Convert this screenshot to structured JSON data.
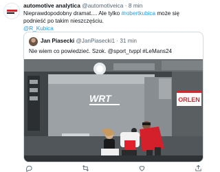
{
  "tweet": {
    "author_name": "automotive analytica",
    "author_handle": "@automotiveica",
    "separator": "·",
    "time": "8 min",
    "text_before_link": "Nieprawdopodobny dramat.... Ale tylko ",
    "link_hashtag": "#robertkubica",
    "text_after_link": " może się podnieść po takim nieszczęściu.",
    "mention": "@R_Kubica"
  },
  "quoted": {
    "author_name": "Jan Piasecki",
    "author_handle": "@JanPiasecki1",
    "separator": "·",
    "time": "31 min",
    "text": "Nie wiem co powiedzieć. Szok. @sport_tvppl #LeMans24",
    "media_brand_left": "WRT",
    "media_brand_right": "ORLEN"
  },
  "actions": {
    "icons": [
      "reply-icon",
      "retweet-icon",
      "like-icon",
      "share-icon"
    ]
  },
  "colors": {
    "link": "#1d9bf0",
    "secondary_text": "#536471",
    "card_border": "#cfd9de",
    "orlen_red": "#e0202a"
  }
}
